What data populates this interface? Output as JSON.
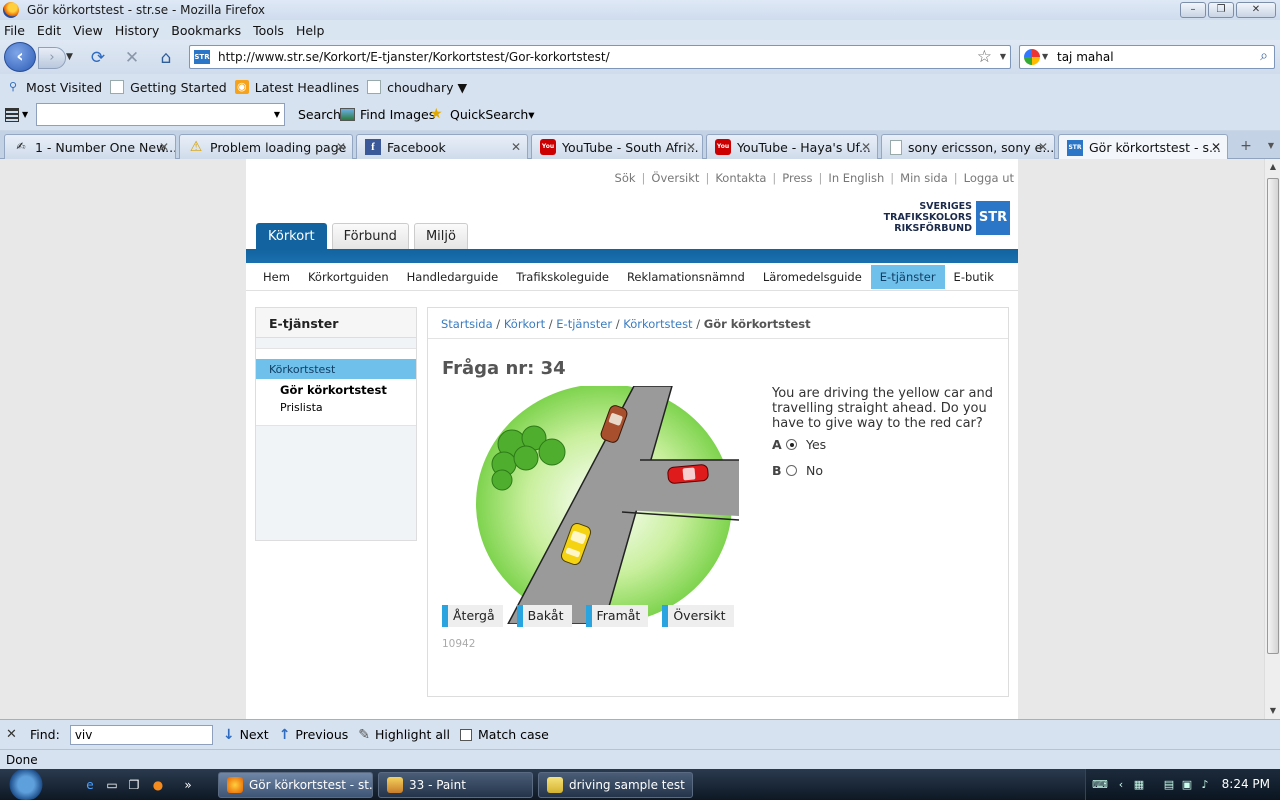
{
  "window": {
    "title": "Gör körkortstest - str.se - Mozilla Firefox"
  },
  "menu": [
    "File",
    "Edit",
    "View",
    "History",
    "Bookmarks",
    "Tools",
    "Help"
  ],
  "nav": {
    "url": "http://www.str.se/Korkort/E-tjanster/Korkortstest/Gor-korkortstest/",
    "search_value": "taj mahal"
  },
  "bookmarks": [
    "Most Visited",
    "Getting Started",
    "Latest Headlines",
    "choudhary ▼"
  ],
  "toolbar2": {
    "search": "Search",
    "find_images": "Find Images",
    "quicksearch": "QuickSearch▾"
  },
  "tabs": [
    {
      "label": "1 - Number One New...",
      "icon": "pen-icon"
    },
    {
      "label": "Problem loading page",
      "icon": "warning-icon"
    },
    {
      "label": "Facebook",
      "icon": "facebook-icon"
    },
    {
      "label": "YouTube - South Afri...",
      "icon": "youtube-icon"
    },
    {
      "label": "YouTube - Haya's Uf...",
      "icon": "youtube-icon"
    },
    {
      "label": "sony ericsson, sony e...",
      "icon": "page-icon"
    },
    {
      "label": "Gör körkortstest - s...",
      "icon": "str-icon"
    }
  ],
  "site": {
    "toplinks": [
      "Sök",
      "Översikt",
      "Kontakta",
      "Press",
      "In English",
      "Min sida",
      "Logga ut"
    ],
    "logo_lines": [
      "SVERIGES",
      "TRAFIKSKOLORS",
      "RIKSFÖRBUND"
    ],
    "logo_box": "STR",
    "main_tabs": [
      "Körkort",
      "Förbund",
      "Miljö"
    ],
    "subnav": [
      "Hem",
      "Körkortguiden",
      "Handledarguide",
      "Trafikskoleguide",
      "Reklamationsnämnd",
      "Läromedelsguide",
      "E-tjänster",
      "E-butik"
    ],
    "sidebar": {
      "heading": "E-tjänster",
      "selected": "Körkortstest",
      "item1": "Gör körkortstest",
      "item2": "Prislista"
    },
    "breadcrumb": [
      "Startsida",
      "Körkort",
      "E-tjänster",
      "Körkortstest"
    ],
    "breadcrumb_current": "Gör körkortstest",
    "question_title": "Fråga nr: 34",
    "question_text": "You are driving the yellow car and travelling straight ahead. Do you have to give way to the red car?",
    "answers": [
      {
        "letter": "A",
        "text": "Yes",
        "selected": true
      },
      {
        "letter": "B",
        "text": "No",
        "selected": false
      }
    ],
    "buttons": [
      "Återgå",
      "Bakåt",
      "Framåt",
      "Översikt"
    ],
    "question_id": "10942"
  },
  "findbar": {
    "label": "Find:",
    "value": "viv",
    "next": "Next",
    "previous": "Previous",
    "highlight": "Highlight all",
    "match_case": "Match case"
  },
  "status": "Done",
  "taskbar": {
    "items": [
      "Gör körkortstest - st...",
      "33 - Paint",
      "driving sample test"
    ],
    "clock": "8:24 PM"
  }
}
